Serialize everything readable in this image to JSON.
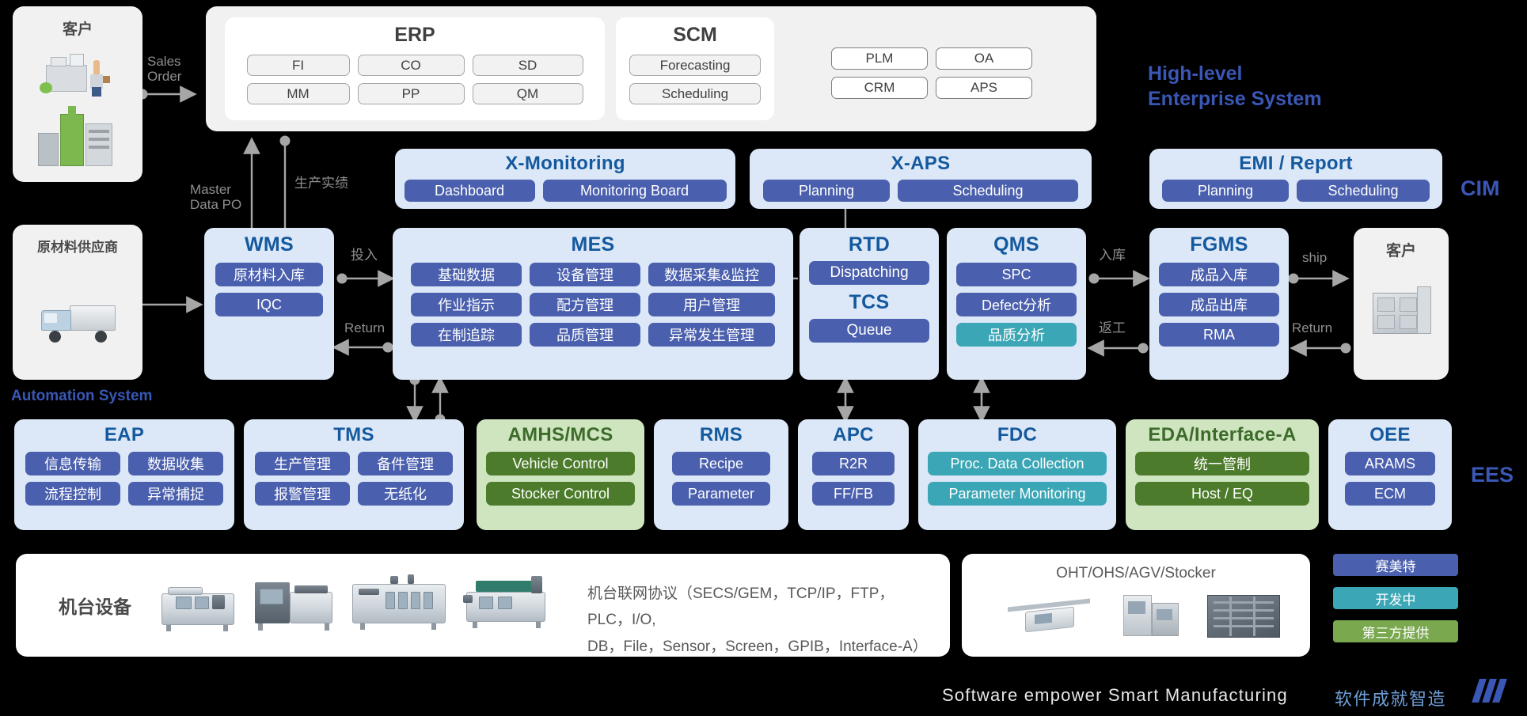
{
  "labels": {
    "high_level": "High-level\nEnterprise System",
    "cim": "CIM",
    "automation_system": "Automation  System",
    "ees": "EES"
  },
  "left_column": {
    "customer_title": "客户",
    "supplier_title": "原材料供应商"
  },
  "right_customer": {
    "title": "客户"
  },
  "top": {
    "erp": {
      "title": "ERP",
      "chips": [
        "FI",
        "CO",
        "SD",
        "MM",
        "PP",
        "QM"
      ]
    },
    "scm": {
      "title": "SCM",
      "chips": [
        "Forecasting",
        "Scheduling"
      ]
    },
    "plain": [
      "PLM",
      "OA",
      "CRM",
      "APS"
    ]
  },
  "cim_row": [
    {
      "title": "X-Monitoring",
      "chips": [
        "Dashboard",
        "Monitoring Board"
      ]
    },
    {
      "title": "X-APS",
      "chips": [
        "Planning",
        "Scheduling"
      ]
    },
    {
      "title": "EMI / Report",
      "chips": [
        "Planning",
        "Scheduling"
      ]
    }
  ],
  "mid_row": {
    "wms": {
      "title": "WMS",
      "chips": [
        "原材料入库",
        "IQC"
      ]
    },
    "mes": {
      "title": "MES",
      "rows": [
        [
          "基础数据",
          "设备管理",
          "数据采集&监控"
        ],
        [
          "作业指示",
          "配方管理",
          "用户管理"
        ],
        [
          "在制追踪",
          "品质管理",
          "异常发生管理"
        ]
      ]
    },
    "rtd": {
      "title": "RTD",
      "chip": "Dispatching",
      "title2": "TCS",
      "chip2": "Queue"
    },
    "qms": {
      "title": "QMS",
      "chips": [
        "SPC",
        "Defect分析",
        "品质分析"
      ]
    },
    "fgms": {
      "title": "FGMS",
      "chips": [
        "成品入库",
        "成品出库",
        "RMA"
      ]
    }
  },
  "ees_row": [
    {
      "title": "EAP",
      "style": "blue",
      "rows": [
        [
          "信息传输",
          "数据收集"
        ],
        [
          "流程控制",
          "异常捕捉"
        ]
      ]
    },
    {
      "title": "TMS",
      "style": "blue",
      "rows": [
        [
          "生产管理",
          "备件管理"
        ],
        [
          "报警管理",
          "无纸化"
        ]
      ]
    },
    {
      "title": "AMHS/MCS",
      "style": "green",
      "rows": [
        [
          "Vehicle Control"
        ],
        [
          "Stocker Control"
        ]
      ]
    },
    {
      "title": "RMS",
      "style": "blue",
      "rows": [
        [
          "Recipe"
        ],
        [
          "Parameter"
        ]
      ]
    },
    {
      "title": "APC",
      "style": "blue",
      "rows": [
        [
          "R2R"
        ],
        [
          "FF/FB"
        ]
      ]
    },
    {
      "title": "FDC",
      "style": "teal",
      "rows": [
        [
          "Proc. Data  Collection"
        ],
        [
          "Parameter  Monitoring"
        ]
      ]
    },
    {
      "title": "EDA/Interface-A",
      "style": "green",
      "rows": [
        [
          "统一管制"
        ],
        [
          "Host / EQ"
        ]
      ]
    },
    {
      "title": "OEE",
      "style": "blue",
      "rows": [
        [
          "ARAMS"
        ],
        [
          "ECM"
        ]
      ]
    }
  ],
  "bottom": {
    "equipment_label": "机台设备",
    "protocol_line1": "机台联网协议（SECS/GEM，TCP/IP，FTP，PLC，I/O,",
    "protocol_line2": "DB，File，Sensor，Screen，GPIB，Interface-A）",
    "oht_label": "OHT/OHS/AGV/Stocker"
  },
  "legend": [
    {
      "text": "赛美特",
      "color": "#4a5fad"
    },
    {
      "text": "开发中",
      "color": "#3ba6b5"
    },
    {
      "text": "第三方提供",
      "color": "#79a84e"
    }
  ],
  "arrow_labels": {
    "sales_order": "Sales\nOrder",
    "master_data_po": "Master\nData PO",
    "production_actual": "生产实绩",
    "input": "投入",
    "return_left": "Return",
    "inbound": "入库",
    "rework": "返工",
    "ship": "ship",
    "return_right": "Return"
  },
  "footer": {
    "en": "Software empower Smart Manufacturing",
    "cn": "软件成就智造"
  }
}
